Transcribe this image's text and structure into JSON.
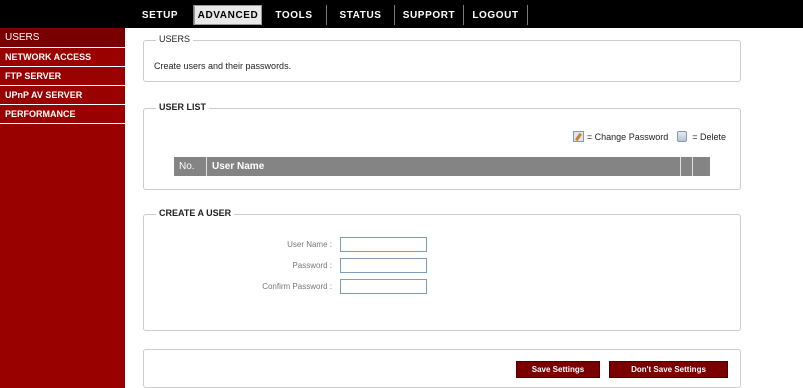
{
  "nav": {
    "tabs": [
      {
        "label": "SETUP"
      },
      {
        "label": "ADVANCED"
      },
      {
        "label": "TOOLS"
      },
      {
        "label": "STATUS"
      },
      {
        "label": "SUPPORT"
      },
      {
        "label": "LOGOUT"
      }
    ],
    "active_tab": "ADVANCED"
  },
  "sidebar": {
    "items": [
      {
        "label": "USERS"
      },
      {
        "label": "NETWORK ACCESS"
      },
      {
        "label": "FTP SERVER"
      },
      {
        "label": "UPnP AV SERVER"
      },
      {
        "label": "PERFORMANCE"
      }
    ]
  },
  "users_section": {
    "title": "USERS",
    "description": "Create users and their passwords."
  },
  "user_list": {
    "title": "USER LIST",
    "change_password_legend": "= Change Password",
    "delete_legend": "= Delete",
    "columns": [
      "No.",
      "User Name",
      "",
      ""
    ]
  },
  "create_user": {
    "title": "CREATE A USER",
    "fields": [
      {
        "label": "User Name :",
        "value": ""
      },
      {
        "label": "Password :",
        "value": ""
      },
      {
        "label": "Confirm Password :",
        "value": ""
      }
    ]
  },
  "actions": {
    "save_label": "Save Settings",
    "dont_save_label": "Don't Save Settings"
  },
  "colors": {
    "sidebar_bg": "#990000",
    "button_bg": "#7a0000",
    "topbar_bg": "#000000",
    "table_header_bg": "#848484"
  }
}
